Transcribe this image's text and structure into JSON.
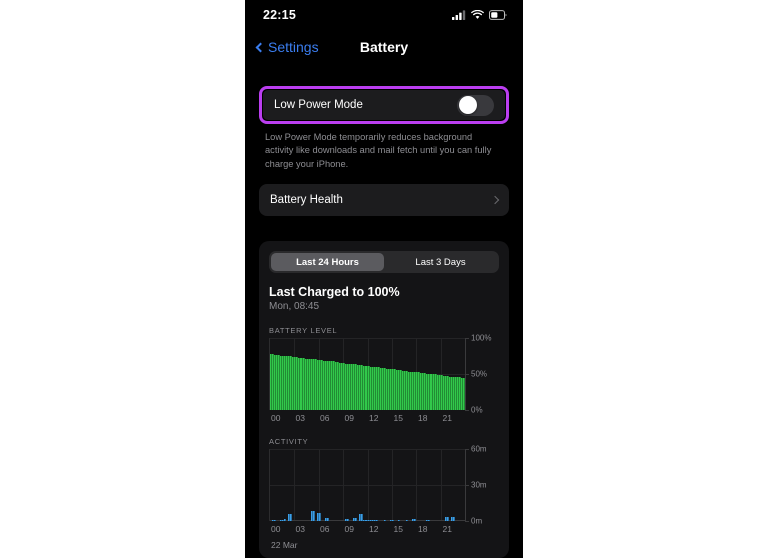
{
  "status_bar": {
    "time": "22:15",
    "icons": [
      "cellular-signal-icon",
      "wifi-icon",
      "battery-icon"
    ]
  },
  "nav": {
    "back_label": "Settings",
    "title": "Battery"
  },
  "low_power_mode": {
    "label": "Low Power Mode",
    "toggle_state": "off",
    "description": "Low Power Mode temporarily reduces background activity like downloads and mail fetch until you can fully charge your iPhone.",
    "highlight_color": "#bb3ef0"
  },
  "battery_health": {
    "label": "Battery Health",
    "chevron": "chevron-right-icon"
  },
  "usage_card": {
    "segments": [
      {
        "label": "Last 24 Hours",
        "selected": true
      },
      {
        "label": "Last 3 Days",
        "selected": false
      }
    ],
    "last_charged_title": "Last Charged to 100%",
    "last_charged_sub": "Mon, 08:45",
    "date_label": "22 Mar"
  },
  "chart_data": [
    {
      "type": "bar",
      "title": "BATTERY LEVEL",
      "xlabel": "",
      "ylabel": "",
      "ylim": [
        0,
        100
      ],
      "yticks": [
        0,
        50,
        100
      ],
      "ytick_labels": [
        "0%",
        "50%",
        "100%"
      ],
      "xtick_labels": [
        "00",
        "03",
        "06",
        "09",
        "12",
        "15",
        "18",
        "21"
      ],
      "grid": true,
      "legend": "none",
      "color": "#32c84b",
      "bar_count": 96,
      "values": [
        78,
        78,
        77,
        77,
        77,
        76,
        76,
        76,
        75,
        75,
        75,
        74,
        74,
        74,
        73,
        73,
        73,
        72,
        72,
        72,
        71,
        71,
        71,
        70,
        70,
        70,
        69,
        69,
        69,
        68,
        68,
        68,
        67,
        67,
        66,
        66,
        66,
        65,
        65,
        65,
        64,
        64,
        64,
        63,
        63,
        63,
        62,
        62,
        62,
        61,
        61,
        60,
        60,
        60,
        59,
        59,
        59,
        58,
        58,
        58,
        57,
        57,
        56,
        56,
        56,
        55,
        55,
        55,
        54,
        54,
        54,
        53,
        53,
        53,
        52,
        52,
        52,
        51,
        51,
        51,
        50,
        50,
        49,
        49,
        49,
        48,
        48,
        48,
        47,
        47,
        47,
        46,
        46,
        46,
        45,
        45
      ]
    },
    {
      "type": "bar",
      "title": "ACTIVITY",
      "xlabel": "",
      "ylabel": "",
      "ylim": [
        0,
        60
      ],
      "yticks": [
        0,
        30,
        60
      ],
      "ytick_labels": [
        "0m",
        "30m",
        "60m"
      ],
      "xtick_labels": [
        "00",
        "03",
        "06",
        "09",
        "12",
        "15",
        "18",
        "21"
      ],
      "grid": true,
      "legend": "none",
      "color": "#3b9fe8",
      "bar_count": 96,
      "values": [
        0,
        1,
        1,
        0,
        0,
        1,
        1,
        2,
        0,
        6,
        6,
        0,
        0,
        0,
        0,
        0,
        0,
        0,
        0,
        0,
        9,
        9,
        0,
        7,
        7,
        0,
        0,
        3,
        3,
        0,
        0,
        0,
        0,
        0,
        0,
        0,
        0,
        2,
        2,
        0,
        0,
        3,
        3,
        0,
        6,
        6,
        1,
        1,
        1,
        1,
        1,
        1,
        1,
        0,
        0,
        0,
        1,
        0,
        0,
        1,
        1,
        0,
        0,
        1,
        0,
        0,
        0,
        1,
        0,
        0,
        2,
        2,
        0,
        0,
        0,
        0,
        0,
        1,
        1,
        0,
        0,
        0,
        0,
        0,
        0,
        0,
        4,
        4,
        0,
        4,
        4,
        0,
        0,
        0,
        0,
        0
      ]
    }
  ]
}
